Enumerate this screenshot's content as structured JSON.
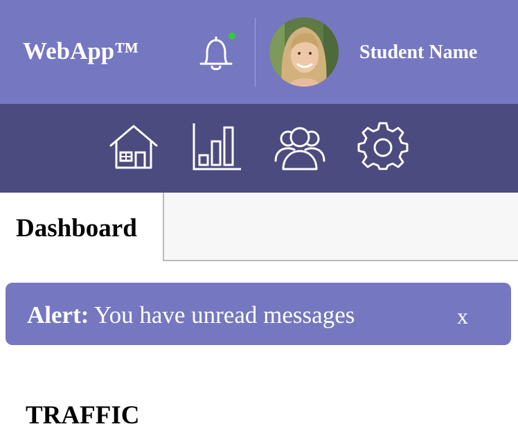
{
  "header": {
    "logo_text": "WebApp™",
    "notification_icon": "bell-icon",
    "has_unread_notifications": true,
    "user": {
      "name": "Student Name",
      "avatar_icon": "user-avatar"
    }
  },
  "nav": {
    "items": [
      {
        "icon": "home-icon"
      },
      {
        "icon": "bar-chart-icon"
      },
      {
        "icon": "users-icon"
      },
      {
        "icon": "gear-icon"
      }
    ]
  },
  "tabs": {
    "active_label": "Dashboard"
  },
  "alert": {
    "label": "Alert:",
    "message": "You have unread messages",
    "close_label": "x"
  },
  "sections": {
    "traffic_title": "TRAFFIC"
  },
  "colors": {
    "header_bg": "#7577c0",
    "nav_bg": "#4b4b7f",
    "alert_bg": "#7577c0",
    "notification_dot": "#33cc33"
  }
}
